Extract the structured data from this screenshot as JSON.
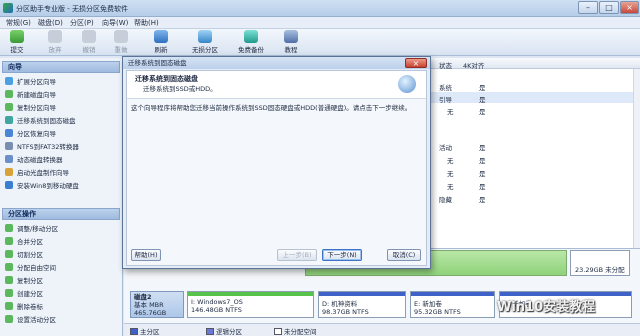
{
  "window": {
    "title": "分区助手专业版 - 无损分区免费软件"
  },
  "menu": [
    "常规(G)",
    "磁盘(D)",
    "分区(P)",
    "向导(W)",
    "帮助(H)"
  ],
  "toolbar": [
    {
      "label": "提交",
      "icon": "check-icon",
      "disabled": false
    },
    {
      "label": "放弃",
      "icon": "discard-icon",
      "disabled": true
    },
    {
      "label": "撤销",
      "icon": "undo-icon",
      "disabled": true
    },
    {
      "label": "重做",
      "icon": "redo-icon",
      "disabled": true
    },
    {
      "label": "刷新",
      "icon": "refresh-icon",
      "disabled": false
    },
    {
      "label": "无损分区",
      "icon": "partition-icon",
      "disabled": false
    },
    {
      "label": "免费备份",
      "icon": "backup-icon",
      "disabled": false
    },
    {
      "label": "教程",
      "icon": "tutorial-icon",
      "disabled": false
    }
  ],
  "sidebar": {
    "wizard_header": "向导",
    "wizard_items": [
      "扩展分区向导",
      "新建磁盘向导",
      "复制分区向导",
      "迁移系统到固态磁盘",
      "分区恢复向导",
      "NTFS到FAT32转换器",
      "动态磁盘转换器",
      "启动光盘制作向导",
      "安装Win8到移动硬盘"
    ],
    "ops_header": "分区操作",
    "ops_items": [
      "调整/移动分区",
      "合并分区",
      "切割分区",
      "分配自由空间",
      "复制分区",
      "创建分区",
      "删除卷标",
      "设置活动分区"
    ]
  },
  "table": {
    "headers": [
      "状态",
      "4K对齐"
    ],
    "rows": [
      {
        "status": "系统",
        "align": "是"
      },
      {
        "status": "引导",
        "align": "是"
      },
      {
        "status": "无",
        "align": "是"
      },
      {
        "status": "",
        "align": ""
      },
      {
        "status": "活动",
        "align": "是"
      },
      {
        "status": "无",
        "align": "是"
      },
      {
        "status": "无",
        "align": "是"
      },
      {
        "status": "无",
        "align": "是"
      },
      {
        "status": "隐藏",
        "align": "是"
      }
    ]
  },
  "disk_map": {
    "disk2_size": "23.29GB 未分配",
    "disk": {
      "name": "磁盘2",
      "type": "基本 MBR",
      "size": "465.76GB"
    },
    "partitions": [
      {
        "label": "I: Windows7_OS",
        "detail": "146.48GB NTFS",
        "color": "#58c34a"
      },
      {
        "label": "D: 机神资料",
        "detail": "98.37GB NTFS",
        "color": "#3f62c8"
      },
      {
        "label": "E: 新加卷",
        "detail": "95.32GB NTFS",
        "color": "#3f62c8"
      },
      {
        "label": "G: 新加卷",
        "detail": "",
        "color": "#3f62c8"
      }
    ]
  },
  "legend": [
    "主分区",
    "逻辑分区",
    "未分配空间"
  ],
  "dialog": {
    "title": "迁移系统到固态磁盘",
    "heading": "迁移系统到固态磁盘",
    "subheading": "迁移系统到SSD或HDD。",
    "body": "这个向导程序将帮助您迁移当前操作系统到SSD固态硬盘或HDD(普通硬盘)。请点击下一步继续。",
    "help": "帮助(H)",
    "back": "上一步(B)",
    "next": "下一步(N)",
    "cancel": "取消(C)"
  },
  "watermark": "Win10安装教程"
}
